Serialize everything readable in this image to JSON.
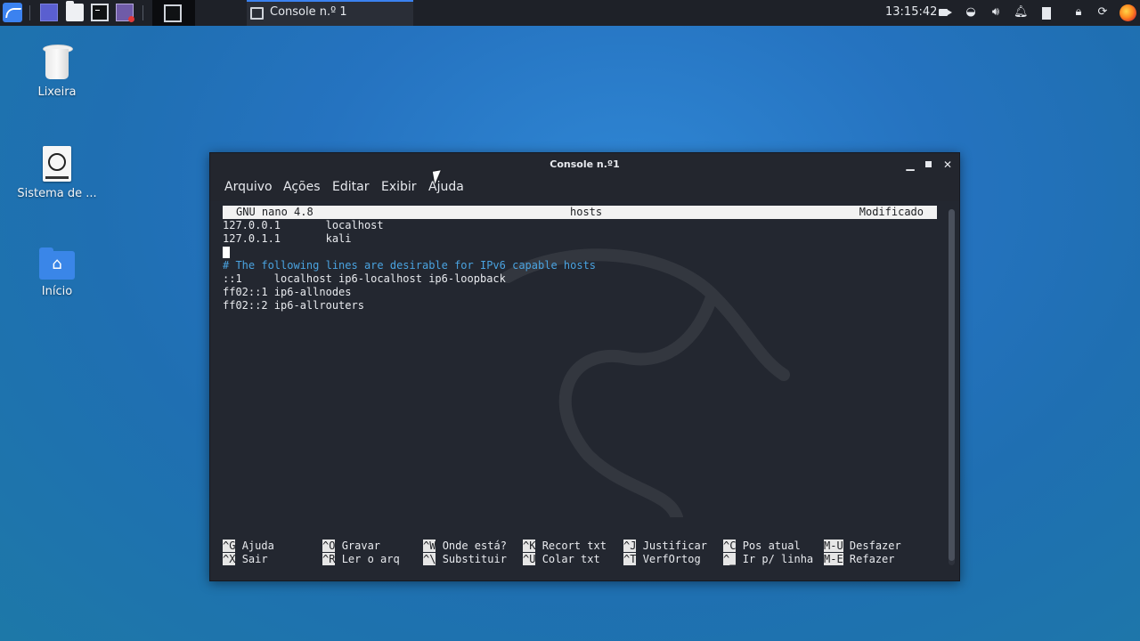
{
  "taskbar": {
    "window_title": "Console n.º 1",
    "clock": "13:15:42"
  },
  "desktop": {
    "icons": [
      {
        "label": "Lixeira",
        "icon": "trash-icon"
      },
      {
        "label": "Sistema de ...",
        "icon": "filesystem-icon"
      },
      {
        "label": "Início",
        "icon": "home-folder-icon"
      }
    ]
  },
  "window": {
    "title": "Console n.º1",
    "menu": [
      "Arquivo",
      "Ações",
      "Editar",
      "Exibir",
      "Ajuda"
    ]
  },
  "nano": {
    "header_left": "GNU nano 4.8",
    "header_center": "hosts",
    "header_right": "Modificado",
    "lines": [
      "127.0.0.1       localhost",
      "127.0.1.1       kali",
      "",
      "# The following lines are desirable for IPv6 capable hosts",
      "::1     localhost ip6-localhost ip6-loopback",
      "ff02::1 ip6-allnodes",
      "ff02::2 ip6-allrouters"
    ],
    "shortcuts_row1": [
      {
        "key": "^G",
        "label": "Ajuda"
      },
      {
        "key": "^O",
        "label": "Gravar"
      },
      {
        "key": "^W",
        "label": "Onde está?"
      },
      {
        "key": "^K",
        "label": "Recort txt"
      },
      {
        "key": "^J",
        "label": "Justificar"
      },
      {
        "key": "^C",
        "label": "Pos atual"
      },
      {
        "key": "M-U",
        "label": "Desfazer"
      }
    ],
    "shortcuts_row2": [
      {
        "key": "^X",
        "label": "Sair"
      },
      {
        "key": "^R",
        "label": "Ler o arq"
      },
      {
        "key": "^\\",
        "label": "Substituir"
      },
      {
        "key": "^U",
        "label": "Colar txt"
      },
      {
        "key": "^T",
        "label": "VerfOrtog"
      },
      {
        "key": "^_",
        "label": "Ir p/ linha"
      },
      {
        "key": "M-E",
        "label": "Refazer"
      }
    ]
  }
}
